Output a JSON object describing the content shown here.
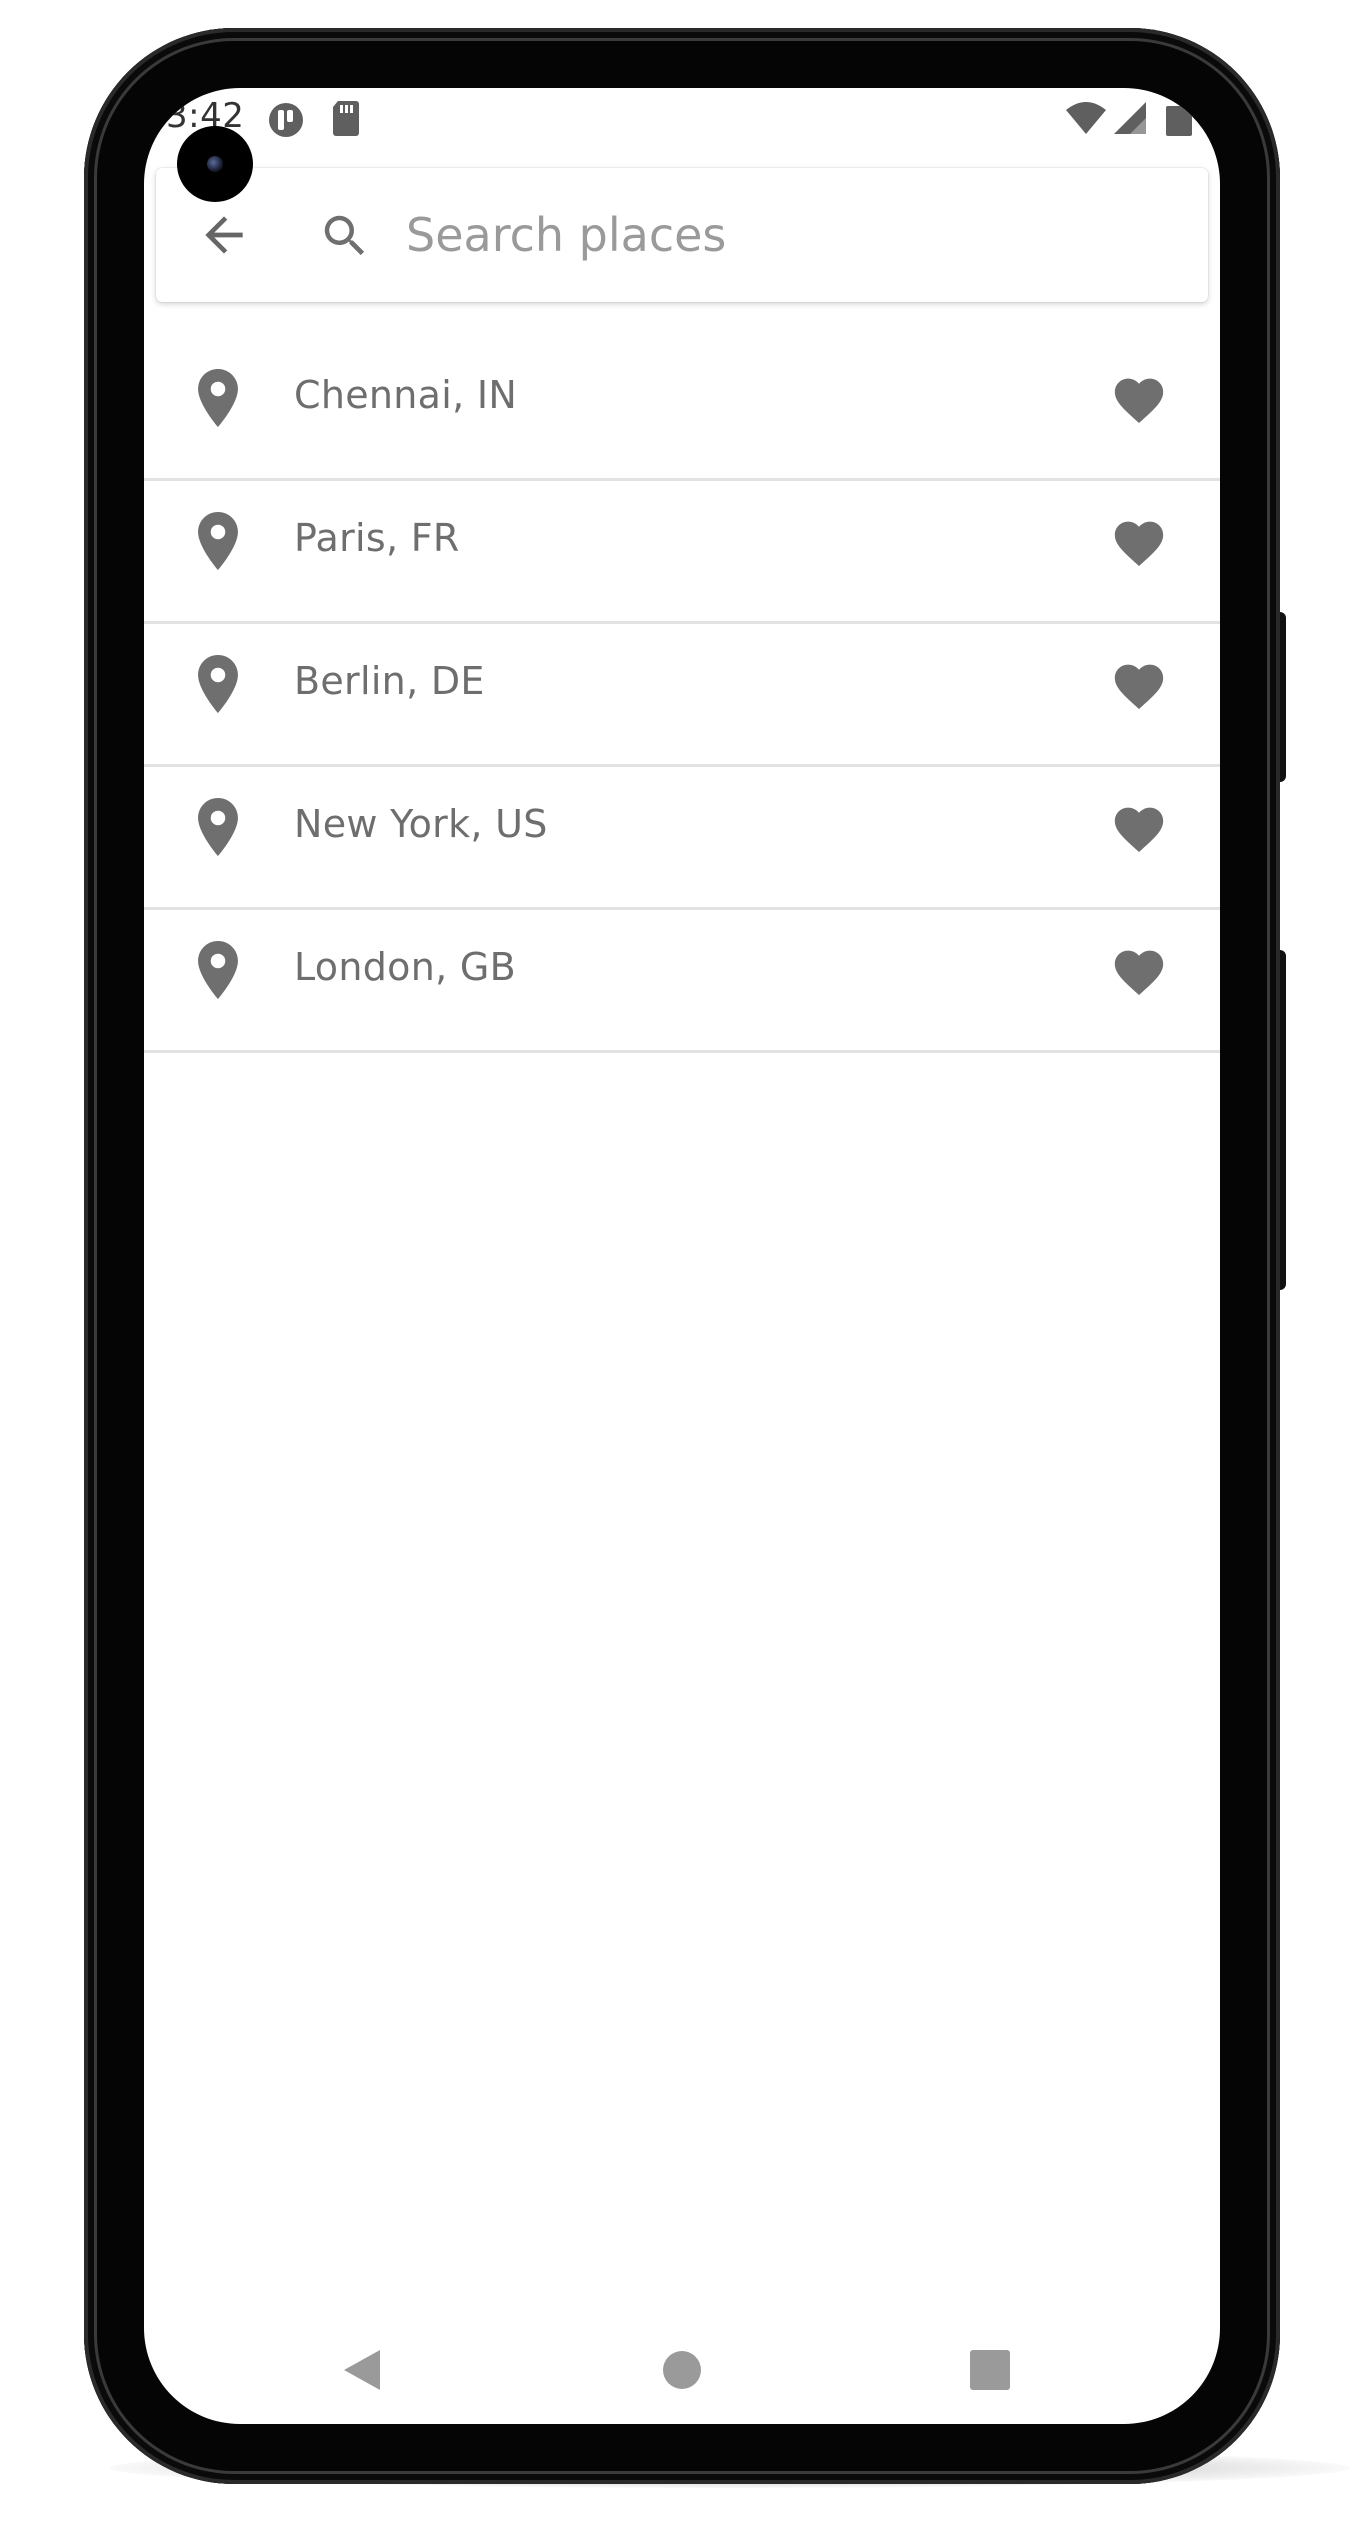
{
  "status_bar": {
    "time": "3:42",
    "icons": [
      "app-notification-icon",
      "sd-card-icon",
      "wifi-icon",
      "cell-signal-icon",
      "battery-icon"
    ]
  },
  "search": {
    "placeholder": "Search places",
    "value": "",
    "back_icon": "arrow-back-icon",
    "search_icon": "search-icon"
  },
  "places": [
    {
      "name": "Chennai, IN",
      "icon": "location-pin-icon",
      "favorite_icon": "heart-icon"
    },
    {
      "name": "Paris, FR",
      "icon": "location-pin-icon",
      "favorite_icon": "heart-icon"
    },
    {
      "name": "Berlin, DE",
      "icon": "location-pin-icon",
      "favorite_icon": "heart-icon"
    },
    {
      "name": "New York, US",
      "icon": "location-pin-icon",
      "favorite_icon": "heart-icon"
    },
    {
      "name": "London, GB",
      "icon": "location-pin-icon",
      "favorite_icon": "heart-icon"
    }
  ],
  "nav_bar": {
    "back": "triangle-back-icon",
    "home": "circle-home-icon",
    "recents": "square-recents-icon"
  },
  "colors": {
    "icon_gray": "#6f6f6f",
    "text_gray": "#6e6e6e",
    "placeholder_gray": "#9a9a9a",
    "divider": "#e2e2e2",
    "nav_gray": "#9a9a9a"
  }
}
